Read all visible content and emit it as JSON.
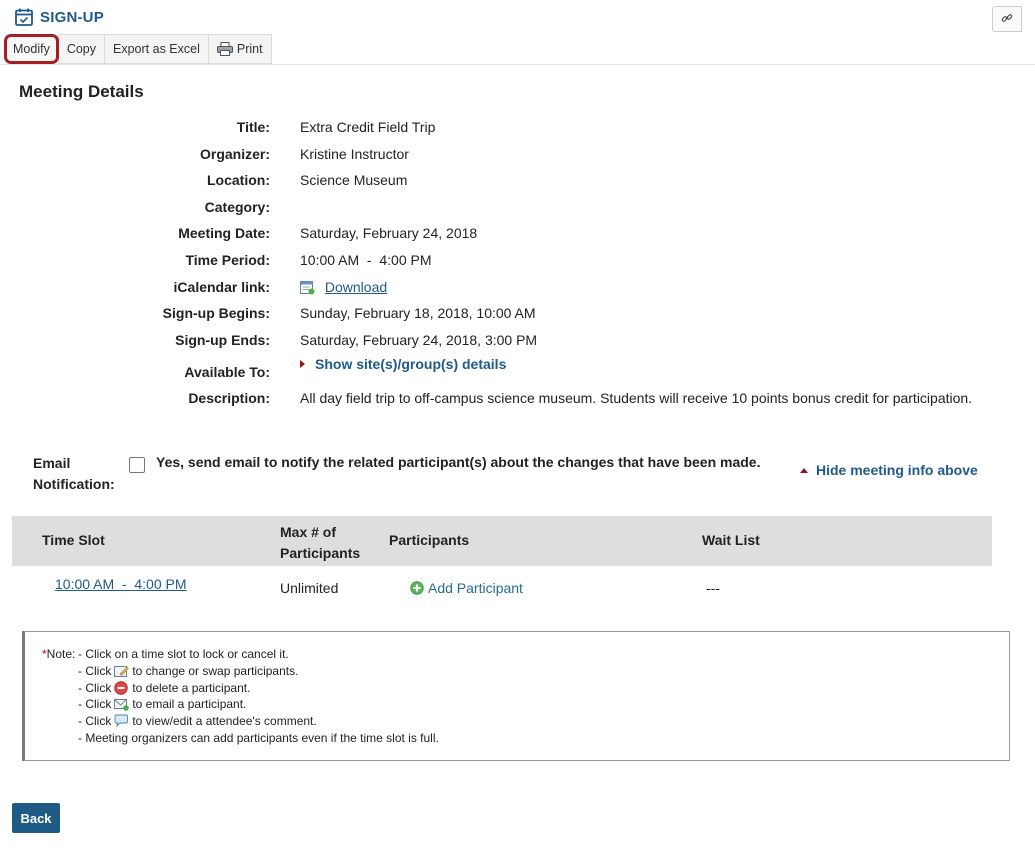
{
  "tool": {
    "title": "SIGN-UP",
    "link_icon": "link-icon",
    "calendar_icon": "calendar-check-icon"
  },
  "toolbar": {
    "modify": "Modify",
    "copy": "Copy",
    "export": "Export as Excel",
    "print": "Print",
    "print_icon": "printer-icon"
  },
  "section_title": "Meeting Details",
  "details": {
    "title_label": "Title:",
    "title": "Extra Credit Field Trip",
    "organizer_label": "Organizer:",
    "organizer": "Kristine Instructor",
    "location_label": "Location:",
    "location": "Science Museum",
    "category_label": "Category:",
    "category": "",
    "date_label": "Meeting Date:",
    "date": "Saturday, February 24, 2018",
    "period_label": "Time Period:",
    "period": "10:00 AM  -  4:00 PM",
    "ical_label": "iCalendar link:",
    "ical_link": "Download",
    "begins_label": "Sign-up Begins:",
    "begins": "Sunday, February 18, 2018, 10:00 AM",
    "ends_label": "Sign-up Ends:",
    "ends": "Saturday, February 24, 2018, 3:00 PM",
    "available_label": "Available To:",
    "available_link": "Show site(s)/group(s) details",
    "description_label": "Description:",
    "description": "All day field trip to off-campus science museum. Students will receive 10 points bonus credit for participation."
  },
  "email": {
    "label_line1": "Email",
    "label_line2": "Notification:",
    "checked": false,
    "text": "Yes, send email to notify the related participant(s) about the changes that have been made."
  },
  "hide_link": "Hide meeting info above",
  "table": {
    "headers": {
      "time_slot": "Time Slot",
      "max_line1": "Max # of",
      "max_line2": "Participants",
      "participants": "Participants",
      "wait_list": "Wait List"
    },
    "rows": [
      {
        "time_slot": "10:00 AM  -  4:00 PM",
        "max": "Unlimited",
        "participants_action": "Add Participant",
        "wait_list": "---"
      }
    ]
  },
  "note": {
    "star": "*",
    "prefix": "Note:",
    "line1": "- Click on a time slot to lock or cancel it.",
    "line2_a": "- Click",
    "line2_b": "to change or swap participants.",
    "line3_a": "- Click",
    "line3_b": "to delete a participant.",
    "line4_a": "- Click",
    "line4_b": "to email a participant.",
    "line5_a": "- Click",
    "line5_b": "to view/edit a attendee's comment.",
    "line6": "- Meeting organizers can add participants even if the time slot is full."
  },
  "back_button": "Back",
  "colors": {
    "accent": "#1f5a8c",
    "highlight_border": "#a31f24",
    "button_bg": "#1d5b85"
  }
}
